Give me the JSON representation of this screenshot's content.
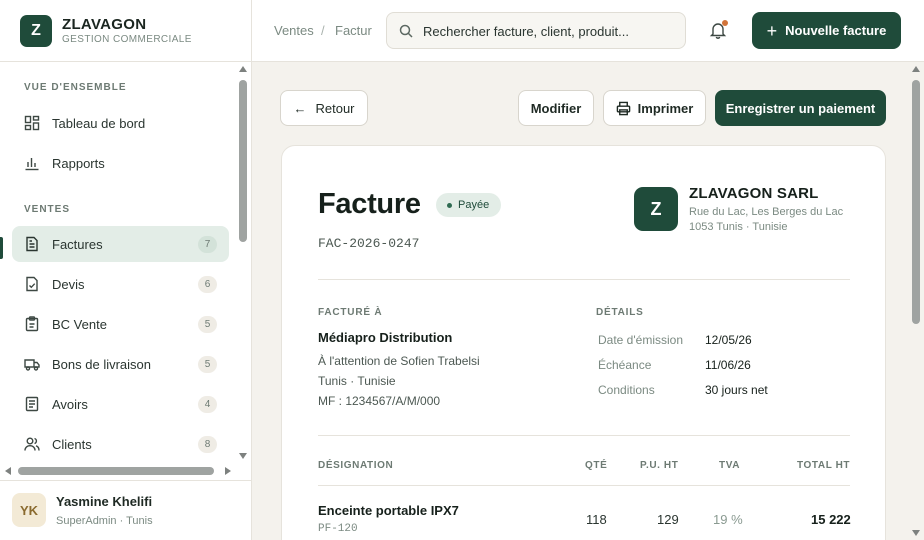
{
  "brand": {
    "logo_letter": "Z",
    "name": "ZLAVAGON",
    "subtitle": "GESTION COMMERCIALE"
  },
  "sidebar": {
    "sections": [
      {
        "label": "VUE D'ENSEMBLE"
      },
      {
        "label": "VENTES"
      }
    ],
    "items": [
      {
        "label": "Tableau de bord",
        "icon": "dashboard-icon"
      },
      {
        "label": "Rapports",
        "icon": "bar-chart-icon"
      },
      {
        "label": "Factures",
        "icon": "invoice-icon",
        "count": "7",
        "active": true
      },
      {
        "label": "Devis",
        "icon": "quote-icon",
        "count": "6"
      },
      {
        "label": "BC Vente",
        "icon": "clipboard-icon",
        "count": "5"
      },
      {
        "label": "Bons de livraison",
        "icon": "truck-icon",
        "count": "5"
      },
      {
        "label": "Avoirs",
        "icon": "credit-note-icon",
        "count": "4"
      },
      {
        "label": "Clients",
        "icon": "users-icon",
        "count": "8"
      }
    ]
  },
  "user": {
    "initials": "YK",
    "name": "Yasmine Khelifi",
    "role": "SuperAdmin · Tunis"
  },
  "topbar": {
    "breadcrumb": [
      "Ventes",
      "/",
      "Factur"
    ],
    "search_placeholder": "Rechercher facture, client, produit...",
    "new_invoice_label": "Nouvelle facture"
  },
  "actions": {
    "back_label": "Retour",
    "edit_label": "Modifier",
    "print_label": "Imprimer",
    "payment_label": "Enregistrer un paiement"
  },
  "invoice": {
    "title": "Facture",
    "status": "Payée",
    "number": "FAC-2026-0247",
    "company": {
      "logo_letter": "Z",
      "name": "ZLAVAGON SARL",
      "address_1": "Rue du Lac, Les Berges du Lac",
      "address_2": "1053 Tunis · Tunisie"
    },
    "billed_to": {
      "label": "FACTURÉ À",
      "name": "Médiapro Distribution",
      "attention": "À l'attention de Sofien Trabelsi",
      "location": "Tunis · Tunisie",
      "tax_id": "MF : 1234567/A/M/000"
    },
    "details": {
      "label": "DÉTAILS",
      "rows": [
        {
          "key": "Date d'émission",
          "value": "12/05/26"
        },
        {
          "key": "Échéance",
          "value": "11/06/26"
        },
        {
          "key": "Conditions",
          "value": "30 jours net"
        }
      ]
    },
    "table": {
      "headers": {
        "designation": "DÉSIGNATION",
        "qty": "QTÉ",
        "unit_price": "P.U. HT",
        "vat": "TVA",
        "total": "TOTAL HT"
      },
      "rows": [
        {
          "designation": "Enceinte portable IPX7",
          "ref": "PF-120",
          "qty": "118",
          "unit_price": "129",
          "vat": "19 %",
          "total": "15 222"
        }
      ]
    }
  },
  "colors": {
    "accent": "#1f4b3a",
    "active_bg": "#e3ede7",
    "notification": "#d1743a"
  }
}
